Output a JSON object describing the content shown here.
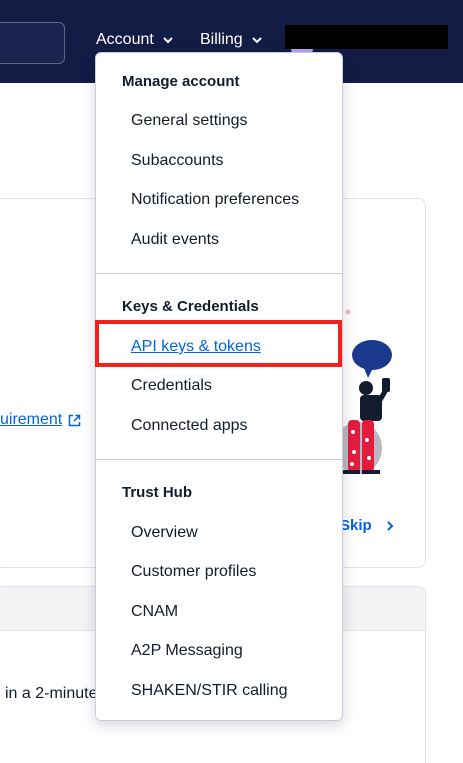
{
  "nav": {
    "account_label": "Account",
    "billing_label": "Billing"
  },
  "account_menu": {
    "groups": [
      {
        "title": "Manage account",
        "items": [
          "General settings",
          "Subaccounts",
          "Notification preferences",
          "Audit events"
        ]
      },
      {
        "title": "Keys & Credentials",
        "items": [
          "API keys & tokens",
          "Credentials",
          "Connected apps"
        ]
      },
      {
        "title": "Trust Hub",
        "items": [
          "Overview",
          "Customer profiles",
          "CNAM",
          "A2P Messaging",
          "SHAKEN/STIR calling"
        ]
      }
    ],
    "highlighted_item": "API keys & tokens"
  },
  "background": {
    "requirement_link": "uirement",
    "skip_label": "Skip",
    "card2_text": "in a 2-minute"
  },
  "icons": {
    "chevron": "chevron-down-icon",
    "external": "external-link-icon",
    "skip": "chevron-right-icon"
  },
  "colors": {
    "topbar": "#121c45",
    "link": "#0263e0",
    "highlight": "#f2211b"
  }
}
